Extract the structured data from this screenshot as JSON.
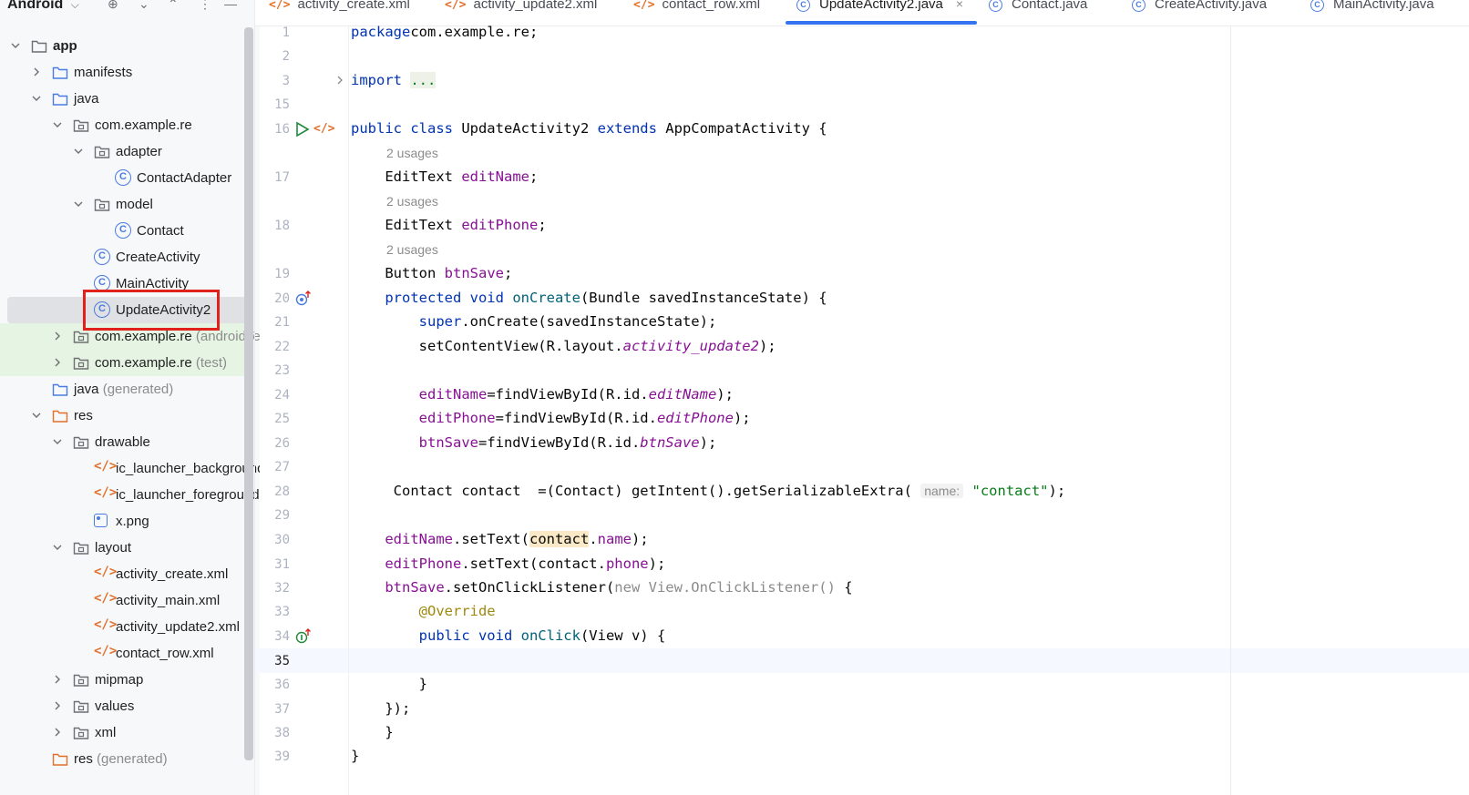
{
  "project_panel": {
    "title": "Android",
    "tree": [
      {
        "label": "app",
        "type": "module",
        "depth": 0,
        "expanded": true
      },
      {
        "label": "manifests",
        "type": "folder",
        "depth": 1,
        "expanded": false
      },
      {
        "label": "java",
        "type": "folder",
        "depth": 1,
        "expanded": true
      },
      {
        "label": "com.example.re",
        "type": "package",
        "depth": 2,
        "expanded": true
      },
      {
        "label": "adapter",
        "type": "package",
        "depth": 3,
        "expanded": true
      },
      {
        "label": "ContactAdapter",
        "type": "class",
        "depth": 4
      },
      {
        "label": "model",
        "type": "package",
        "depth": 3,
        "expanded": true
      },
      {
        "label": "Contact",
        "type": "class",
        "depth": 4
      },
      {
        "label": "CreateActivity",
        "type": "class",
        "depth": 3
      },
      {
        "label": "MainActivity",
        "type": "class",
        "depth": 3
      },
      {
        "label": "UpdateActivity2",
        "type": "class",
        "depth": 3,
        "selected": true
      },
      {
        "label": "com.example.re",
        "hint": "(androidTe",
        "type": "package",
        "depth": 2,
        "expanded": false,
        "test": true
      },
      {
        "label": "com.example.re",
        "hint": "(test)",
        "type": "package",
        "depth": 2,
        "expanded": false,
        "test": true
      },
      {
        "label": "java",
        "hint": "(generated)",
        "type": "gen-folder",
        "depth": 1
      },
      {
        "label": "res",
        "type": "res-folder",
        "depth": 1,
        "expanded": true
      },
      {
        "label": "drawable",
        "type": "package",
        "depth": 2,
        "expanded": true
      },
      {
        "label": "ic_launcher_background",
        "type": "xml",
        "depth": 3
      },
      {
        "label": "ic_launcher_foreground",
        "type": "xml",
        "depth": 3
      },
      {
        "label": "x.png",
        "type": "image",
        "depth": 3
      },
      {
        "label": "layout",
        "type": "package",
        "depth": 2,
        "expanded": true
      },
      {
        "label": "activity_create.xml",
        "type": "xml",
        "depth": 3
      },
      {
        "label": "activity_main.xml",
        "type": "xml",
        "depth": 3
      },
      {
        "label": "activity_update2.xml",
        "type": "xml",
        "depth": 3
      },
      {
        "label": "contact_row.xml",
        "type": "xml",
        "depth": 3
      },
      {
        "label": "mipmap",
        "type": "package",
        "depth": 2,
        "expanded": false
      },
      {
        "label": "values",
        "type": "package",
        "depth": 2,
        "expanded": false
      },
      {
        "label": "xml",
        "type": "package",
        "depth": 2,
        "expanded": false
      },
      {
        "label": "res",
        "hint": "(generated)",
        "type": "res-folder",
        "depth": 1
      }
    ]
  },
  "tabs": [
    {
      "label": "activity_create.xml",
      "icon": "xml-file-icon"
    },
    {
      "label": "activity_update2.xml",
      "icon": "xml-file-icon"
    },
    {
      "label": "contact_row.xml",
      "icon": "xml-file-icon"
    },
    {
      "label": "UpdateActivity2.java",
      "icon": "java-class-icon",
      "active": true,
      "close": "×"
    },
    {
      "label": "Contact.java",
      "icon": "java-class-icon"
    },
    {
      "label": "CreateActivity.java",
      "icon": "java-class-icon"
    },
    {
      "label": "MainActivity.java",
      "icon": "java-class-icon"
    }
  ],
  "editor": {
    "current_line": 35,
    "usage_hint": "2 usages",
    "param_hint": "name:",
    "lines": [
      {
        "n": 1,
        "tokens": [
          [
            "kw",
            "package"
          ],
          [
            "",
            "com.example.re;"
          ]
        ]
      },
      {
        "n": 2,
        "tokens": []
      },
      {
        "n": 3,
        "tokens": [
          [
            "kw",
            "import"
          ],
          [
            "",
            " "
          ],
          [
            "fold",
            "..."
          ]
        ],
        "fold_arrow": true
      },
      {
        "n": 15,
        "tokens": []
      },
      {
        "n": 16,
        "tokens": [
          [
            "kw",
            "public class"
          ],
          [
            "",
            " UpdateActivity2 "
          ],
          [
            "kw",
            "extends"
          ],
          [
            "",
            " AppCompatActivity {"
          ]
        ],
        "gutter": "run"
      },
      {
        "n": 17,
        "usages": "2 usages",
        "tokens": [
          [
            "",
            "    EditText "
          ],
          [
            "fld",
            "editName"
          ],
          [
            "",
            ";"
          ]
        ]
      },
      {
        "n": 18,
        "usages": "2 usages",
        "tokens": [
          [
            "",
            "    EditText "
          ],
          [
            "fld",
            "editPhone"
          ],
          [
            "",
            ";"
          ]
        ]
      },
      {
        "n": 19,
        "usages": "2 usages",
        "tokens": [
          [
            "",
            "    Button "
          ],
          [
            "fld",
            "btnSave"
          ],
          [
            "",
            ";"
          ]
        ]
      },
      {
        "n": 20,
        "tokens": [
          [
            "kw",
            "    protected void "
          ],
          [
            "mth",
            "onCreate"
          ],
          [
            "",
            "(Bundle savedInstanceState) {"
          ]
        ],
        "gutter": "override"
      },
      {
        "n": 21,
        "tokens": [
          [
            "kw",
            "        super"
          ],
          [
            "",
            ".onCreate(savedInstanceState);"
          ]
        ]
      },
      {
        "n": 22,
        "tokens": [
          [
            "",
            "        setContentView(R.layout."
          ],
          [
            "fldi",
            "activity_update2"
          ],
          [
            "",
            ");"
          ]
        ]
      },
      {
        "n": 23,
        "tokens": []
      },
      {
        "n": 24,
        "tokens": [
          [
            "fld",
            "        editName"
          ],
          [
            "",
            "=findViewById(R.id."
          ],
          [
            "fldi",
            "editName"
          ],
          [
            "",
            ");"
          ]
        ]
      },
      {
        "n": 25,
        "tokens": [
          [
            "fld",
            "        editPhone"
          ],
          [
            "",
            "=findViewById(R.id."
          ],
          [
            "fldi",
            "editPhone"
          ],
          [
            "",
            ");"
          ]
        ]
      },
      {
        "n": 26,
        "tokens": [
          [
            "fld",
            "        btnSave"
          ],
          [
            "",
            "=findViewById(R.id."
          ],
          [
            "fldi",
            "btnSave"
          ],
          [
            "",
            ");"
          ]
        ]
      },
      {
        "n": 27,
        "tokens": []
      },
      {
        "n": 28,
        "tokens": [
          [
            "",
            "     Contact contact  =(Contact) getIntent().getSerializableExtra( "
          ],
          [
            "hint",
            "name:"
          ],
          [
            "",
            " "
          ],
          [
            "str",
            "\"contact\""
          ],
          [
            "",
            ");"
          ]
        ]
      },
      {
        "n": 29,
        "tokens": []
      },
      {
        "n": 30,
        "tokens": [
          [
            "fld",
            "    editName"
          ],
          [
            "",
            ".setText("
          ],
          [
            "hl",
            "contact"
          ],
          [
            "",
            "."
          ],
          [
            "fld",
            "name"
          ],
          [
            "",
            ");"
          ]
        ]
      },
      {
        "n": 31,
        "tokens": [
          [
            "fld",
            "    editPhone"
          ],
          [
            "",
            ".setText(contact."
          ],
          [
            "fld",
            "phone"
          ],
          [
            "",
            ");"
          ]
        ]
      },
      {
        "n": 32,
        "tokens": [
          [
            "fld",
            "    btnSave"
          ],
          [
            "",
            ".setOnClickListener("
          ],
          [
            "gray",
            "new View.OnClickListener()"
          ],
          [
            "",
            " {"
          ]
        ]
      },
      {
        "n": 33,
        "tokens": [
          [
            "ann",
            "        @Override"
          ]
        ]
      },
      {
        "n": 34,
        "tokens": [
          [
            "kw",
            "        public void "
          ],
          [
            "mth",
            "onClick"
          ],
          [
            "",
            "(View v) {"
          ]
        ],
        "gutter": "implement"
      },
      {
        "n": 35,
        "tokens": []
      },
      {
        "n": 36,
        "tokens": [
          [
            "",
            "        }"
          ]
        ]
      },
      {
        "n": 37,
        "tokens": [
          [
            "",
            "    });"
          ]
        ]
      },
      {
        "n": 38,
        "tokens": [
          [
            "",
            "    }"
          ]
        ]
      },
      {
        "n": 39,
        "tokens": [
          [
            "",
            "}"
          ]
        ]
      }
    ]
  }
}
